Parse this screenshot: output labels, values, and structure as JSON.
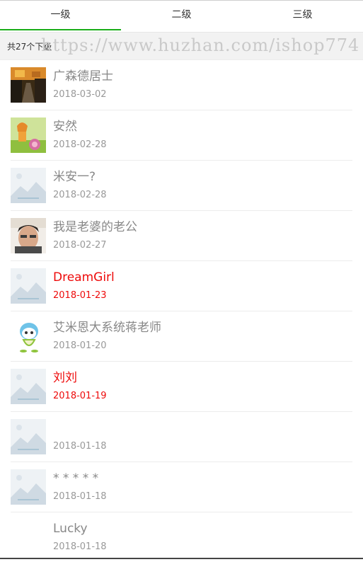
{
  "tabs": [
    {
      "label": "一级",
      "active": true
    },
    {
      "label": "二级",
      "active": false
    },
    {
      "label": "三级",
      "active": false
    }
  ],
  "summary": "共27个下级",
  "watermark": "https://www.huzhan.com/ishop774",
  "colors": {
    "accent": "#1aad19",
    "highlight": "#ee0a0a",
    "muted": "#888888"
  },
  "members": [
    {
      "name": "广森德居士",
      "date": "2018-03-02",
      "avatar": "photo-street",
      "highlight": false
    },
    {
      "name": "安然",
      "date": "2018-02-28",
      "avatar": "photo-cartoon-girl",
      "highlight": false
    },
    {
      "name": "米安一?",
      "date": "2018-02-28",
      "avatar": "placeholder-image",
      "highlight": false
    },
    {
      "name": "我是老婆的老公",
      "date": "2018-02-27",
      "avatar": "photo-selfie",
      "highlight": false
    },
    {
      "name": "DreamGirl",
      "date": "2018-01-23",
      "avatar": "placeholder-image",
      "highlight": true
    },
    {
      "name": "艾米恩大系统蒋老师",
      "date": "2018-01-20",
      "avatar": "cartoon-mascot",
      "highlight": false
    },
    {
      "name": "刘刘",
      "date": "2018-01-19",
      "avatar": "placeholder-image",
      "highlight": true
    },
    {
      "name": "",
      "date": "2018-01-18",
      "avatar": "placeholder-image",
      "highlight": false
    },
    {
      "name": "* * * * *",
      "date": "2018-01-18",
      "avatar": "placeholder-image",
      "highlight": false
    },
    {
      "name": "Lucky",
      "date": "2018-01-18",
      "avatar": "none",
      "highlight": false
    }
  ]
}
